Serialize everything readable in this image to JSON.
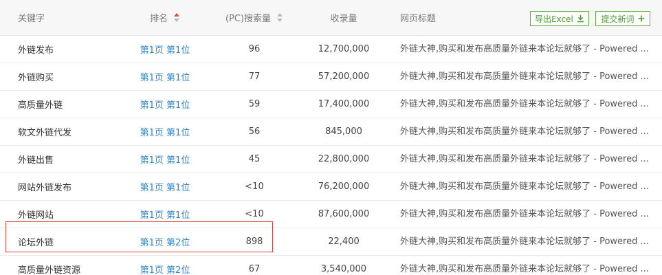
{
  "header": {
    "keyword": "关键字",
    "rank": "排名",
    "search_volume": "(PC)搜索量",
    "indexed": "收录量",
    "page_title": "网页标题",
    "export_button": "导出Excel",
    "submit_button": "提交新词",
    "rank_sort_state": "descending-active",
    "accent_color": "#4c9a33",
    "highlight_color": "#e23e3e",
    "link_color": "#2f84c5"
  },
  "rows": [
    {
      "keyword": "外链发布",
      "rank": "第1页 第1位",
      "search_volume": "96",
      "indexed": "12,700,000",
      "title": "外链大神,购买和发布高质量外链来本论坛就够了 - Powered ..."
    },
    {
      "keyword": "外链购买",
      "rank": "第1页 第1位",
      "search_volume": "77",
      "indexed": "57,200,000",
      "title": "外链大神,购买和发布高质量外链来本论坛就够了 - Powered ..."
    },
    {
      "keyword": "高质量外链",
      "rank": "第1页 第1位",
      "search_volume": "59",
      "indexed": "17,400,000",
      "title": "外链大神,购买和发布高质量外链来本论坛就够了 - Powered ..."
    },
    {
      "keyword": "软文外链代发",
      "rank": "第1页 第1位",
      "search_volume": "56",
      "indexed": "845,000",
      "title": "外链大神,购买和发布高质量外链来本论坛就够了 - Powered ..."
    },
    {
      "keyword": "外链出售",
      "rank": "第1页 第1位",
      "search_volume": "45",
      "indexed": "22,800,000",
      "title": "外链大神,购买和发布高质量外链来本论坛就够了 - Powered ..."
    },
    {
      "keyword": "网站外链发布",
      "rank": "第1页 第1位",
      "search_volume": "<10",
      "indexed": "76,200,000",
      "title": "外链大神,购买和发布高质量外链来本论坛就够了 - Powered ..."
    },
    {
      "keyword": "外链网站",
      "rank": "第1页 第1位",
      "search_volume": "<10",
      "indexed": "87,600,000",
      "title": "外链大神,购买和发布高质量外链来本论坛就够了 - Powered ..."
    },
    {
      "keyword": "论坛外链",
      "rank": "第1页 第2位",
      "search_volume": "898",
      "indexed": "22,400",
      "title": "外链大神,购买和发布高质量外链来本论坛就够了 - Powered ..."
    },
    {
      "keyword": "高质量外链资源",
      "rank": "第1页 第2位",
      "search_volume": "67",
      "indexed": "3,540,000",
      "title": "外链大神,购买和发布高质量外链来本论坛就够了 - Powered ..."
    }
  ]
}
